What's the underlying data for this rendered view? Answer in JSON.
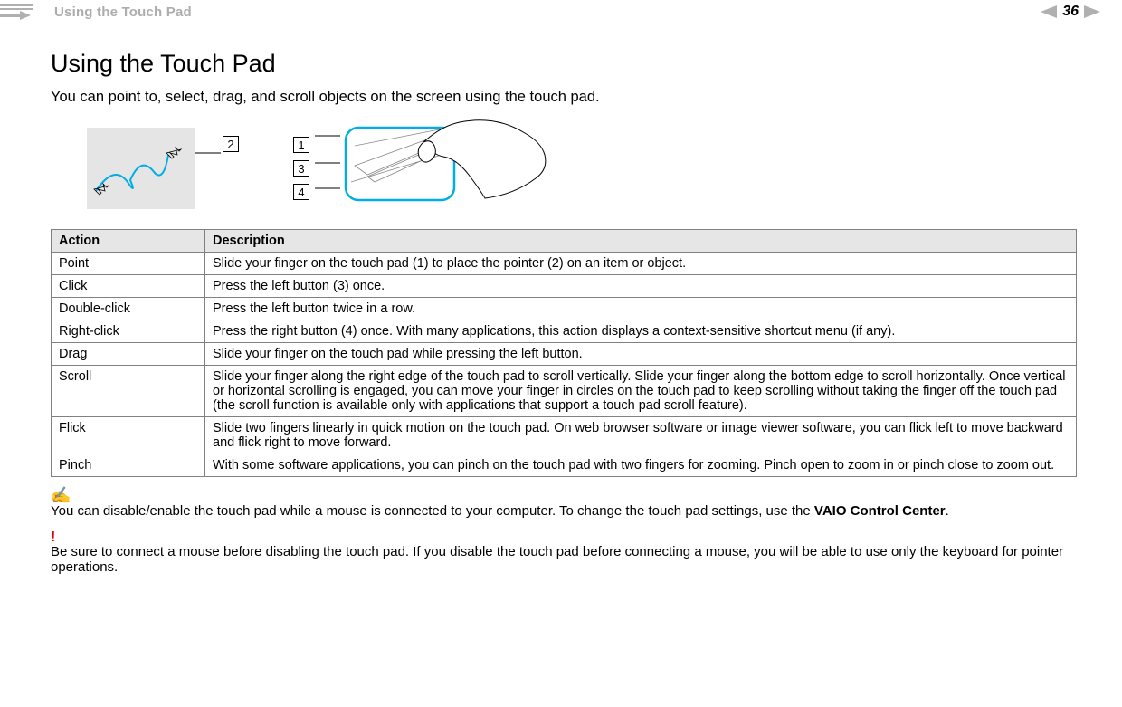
{
  "header": {
    "section_title": "Using the Touch Pad",
    "page_number": "36",
    "nav_left_aria": "previous-page",
    "nav_right_aria": "next-page"
  },
  "page": {
    "title": "Using the Touch Pad",
    "intro": "You can point to, select, drag, and scroll objects on the screen using the touch pad."
  },
  "callouts": {
    "c1": "1",
    "c2": "2",
    "c3": "3",
    "c4": "4"
  },
  "table": {
    "headers": {
      "action": "Action",
      "description": "Description"
    },
    "rows": [
      {
        "action": "Point",
        "description": "Slide your finger on the touch pad (1) to place the pointer (2) on an item or object."
      },
      {
        "action": "Click",
        "description": "Press the left button (3) once."
      },
      {
        "action": "Double-click",
        "description": "Press the left button twice in a row."
      },
      {
        "action": "Right-click",
        "description": "Press the right button (4) once. With many applications, this action displays a context-sensitive shortcut menu (if any)."
      },
      {
        "action": "Drag",
        "description": "Slide your finger on the touch pad while pressing the left button."
      },
      {
        "action": "Scroll",
        "description": "Slide your finger along the right edge of the touch pad to scroll vertically. Slide your finger along the bottom edge to scroll horizontally. Once vertical or horizontal scrolling is engaged, you can move your finger in circles on the touch pad to keep scrolling without taking the finger off the touch pad (the scroll function is available only with applications that support a touch pad scroll feature)."
      },
      {
        "action": "Flick",
        "description": "Slide two fingers linearly in quick motion on the touch pad. On web browser software or image viewer software, you can flick left to move backward and flick right to move forward."
      },
      {
        "action": "Pinch",
        "description": "With some software applications, you can pinch on the touch pad with two fingers for zooming. Pinch open to zoom in or pinch close to zoom out."
      }
    ]
  },
  "note": {
    "icon": "✍",
    "text_prefix": "You can disable/enable the touch pad while a mouse is connected to your computer. To change the touch pad settings, use the ",
    "bold": "VAIO Control Center",
    "text_suffix": "."
  },
  "warning": {
    "icon": "!",
    "text": "Be sure to connect a mouse before disabling the touch pad. If you disable the touch pad before connecting a mouse, you will be able to use only the keyboard for pointer operations."
  }
}
